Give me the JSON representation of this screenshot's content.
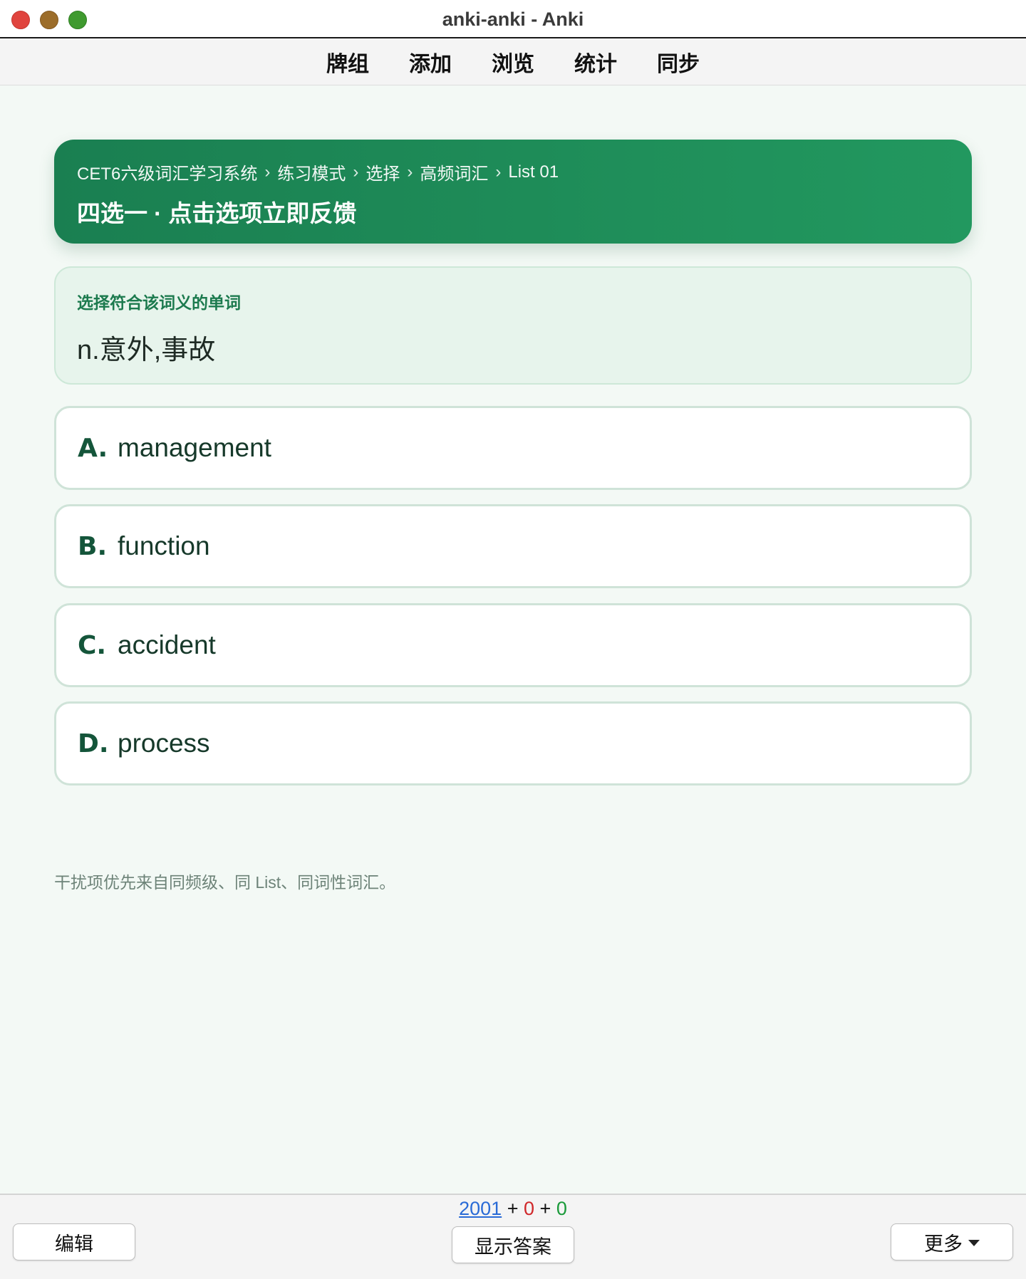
{
  "window": {
    "title": "anki-anki - Anki"
  },
  "nav": {
    "items": [
      "牌组",
      "添加",
      "浏览",
      "统计",
      "同步"
    ]
  },
  "hero": {
    "breadcrumb": [
      "CET6六级词汇学习系统",
      "练习模式",
      "选择",
      "高频词汇",
      "List 01"
    ],
    "separator": "›",
    "title": "四选一 · 点击选项立即反馈"
  },
  "prompt": {
    "label": "选择符合该词义的单词",
    "definition": "n.意外,事故"
  },
  "options": [
    {
      "letter": "A.",
      "word": "management"
    },
    {
      "letter": "B.",
      "word": "function"
    },
    {
      "letter": "C.",
      "word": "accident"
    },
    {
      "letter": "D.",
      "word": "process"
    }
  ],
  "note": "干扰项优先来自同频级、同 List、同词性词汇。",
  "bottom": {
    "edit_label": "编辑",
    "show_answer_label": "显示答案",
    "more_label": "更多",
    "counts": {
      "new": "2001",
      "plus1": "+",
      "learn": "0",
      "plus2": "+",
      "review": "0"
    }
  },
  "colors": {
    "accent": "#1f8f5a",
    "new_count": "#2a6bd6",
    "learn_count": "#d0282b",
    "review_count": "#1a9a3a"
  }
}
